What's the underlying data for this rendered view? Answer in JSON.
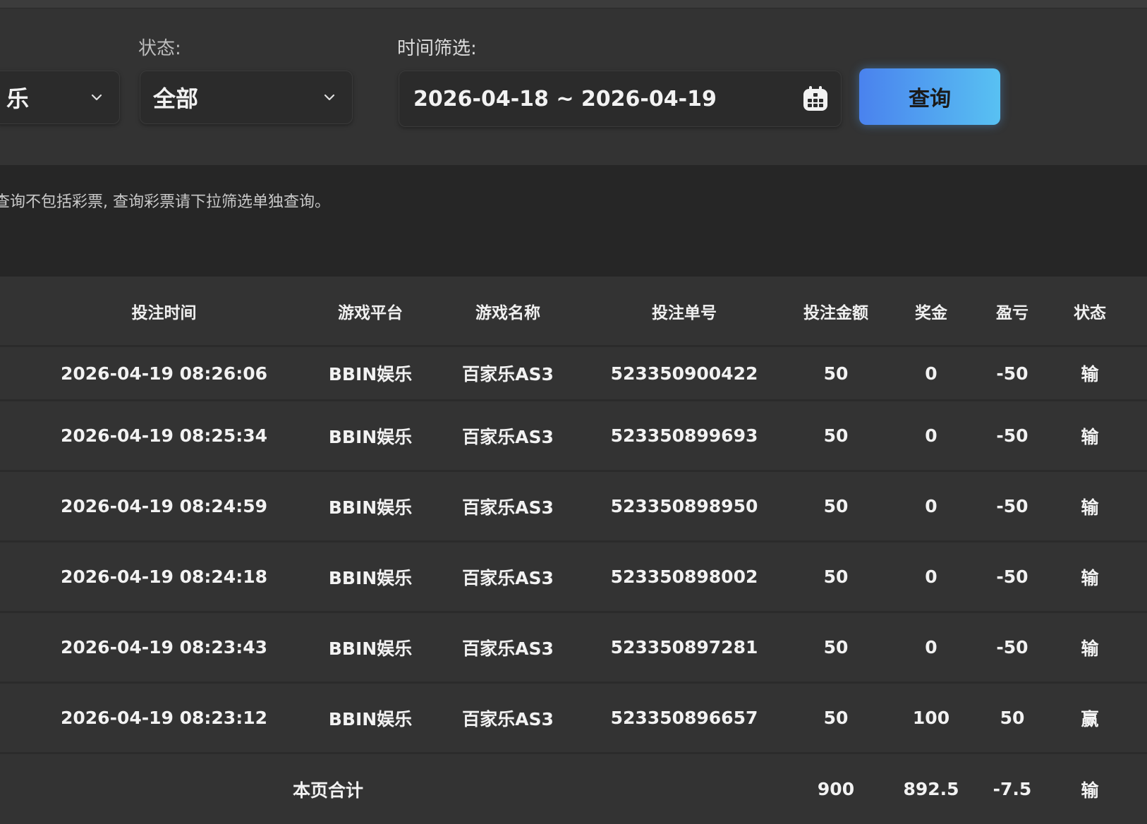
{
  "filters": {
    "platform_value": "乐",
    "status_label": "状态:",
    "status_value": "全部",
    "time_label": "时间筛选:",
    "date_range": "2026-04-18 ~ 2026-04-19",
    "query_button": "查询"
  },
  "notice": "查询不包括彩票, 查询彩票请下拉筛选单独查询。",
  "table": {
    "headers": [
      "投注时间",
      "游戏平台",
      "游戏名称",
      "投注单号",
      "投注金额",
      "奖金",
      "盈亏",
      "状态"
    ],
    "rows": [
      [
        "2026-04-19 08:26:06",
        "BBIN娱乐",
        "百家乐AS3",
        "523350900422",
        "50",
        "0",
        "-50",
        "输"
      ],
      [
        "2026-04-19 08:25:34",
        "BBIN娱乐",
        "百家乐AS3",
        "523350899693",
        "50",
        "0",
        "-50",
        "输"
      ],
      [
        "2026-04-19 08:24:59",
        "BBIN娱乐",
        "百家乐AS3",
        "523350898950",
        "50",
        "0",
        "-50",
        "输"
      ],
      [
        "2026-04-19 08:24:18",
        "BBIN娱乐",
        "百家乐AS3",
        "523350898002",
        "50",
        "0",
        "-50",
        "输"
      ],
      [
        "2026-04-19 08:23:43",
        "BBIN娱乐",
        "百家乐AS3",
        "523350897281",
        "50",
        "0",
        "-50",
        "输"
      ],
      [
        "2026-04-19 08:23:12",
        "BBIN娱乐",
        "百家乐AS3",
        "523350896657",
        "50",
        "100",
        "50",
        "赢"
      ]
    ],
    "total": {
      "label": "本页合计",
      "bet_amount": "900",
      "bonus": "892.5",
      "profit": "-7.5",
      "status": "输"
    }
  },
  "colors": {
    "accent_start": "#4a82ee",
    "accent_end": "#58c1f2",
    "background": "#323232"
  },
  "icons": [
    "chevron-down-icon",
    "calendar-icon"
  ]
}
